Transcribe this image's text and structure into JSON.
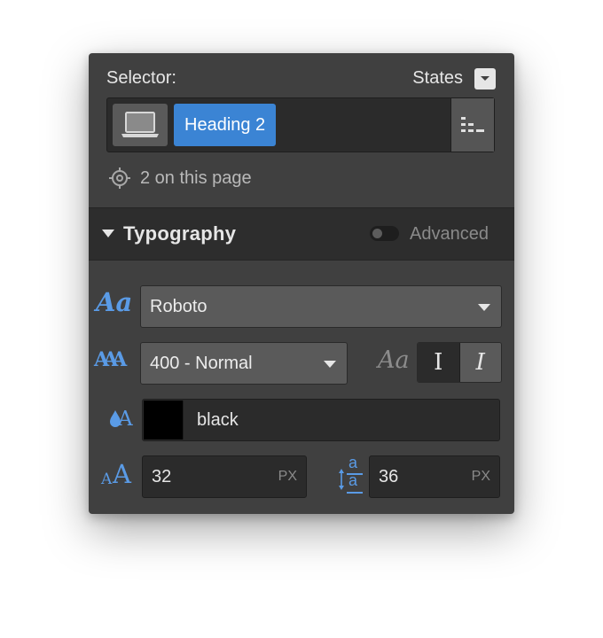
{
  "selector": {
    "label": "Selector:",
    "states_label": "States",
    "chip_label": "Heading 2",
    "on_page_text": "2 on this page"
  },
  "typography": {
    "section_title": "Typography",
    "advanced_label": "Advanced",
    "font_family": "Roboto",
    "font_weight": "400 - Normal",
    "color_name": "black",
    "color_swatch": "#000000",
    "font_size": "32",
    "font_size_unit": "PX",
    "line_height": "36",
    "line_height_unit": "PX",
    "style_preview_glyph": "Aa",
    "normal_style_glyph": "I",
    "italic_style_glyph": "I"
  },
  "icons": {
    "font_family_glyph": "Aa",
    "font_weight_glyph": "AAA",
    "font_size_small_glyph": "A",
    "font_size_large_glyph": "A",
    "line_height_top_glyph": "a",
    "line_height_bottom_glyph": "a",
    "color_glyph": "A"
  },
  "colors": {
    "panel_bg": "#404040",
    "accent_blue": "#3b84d4",
    "icon_blue": "#5a9be6"
  }
}
